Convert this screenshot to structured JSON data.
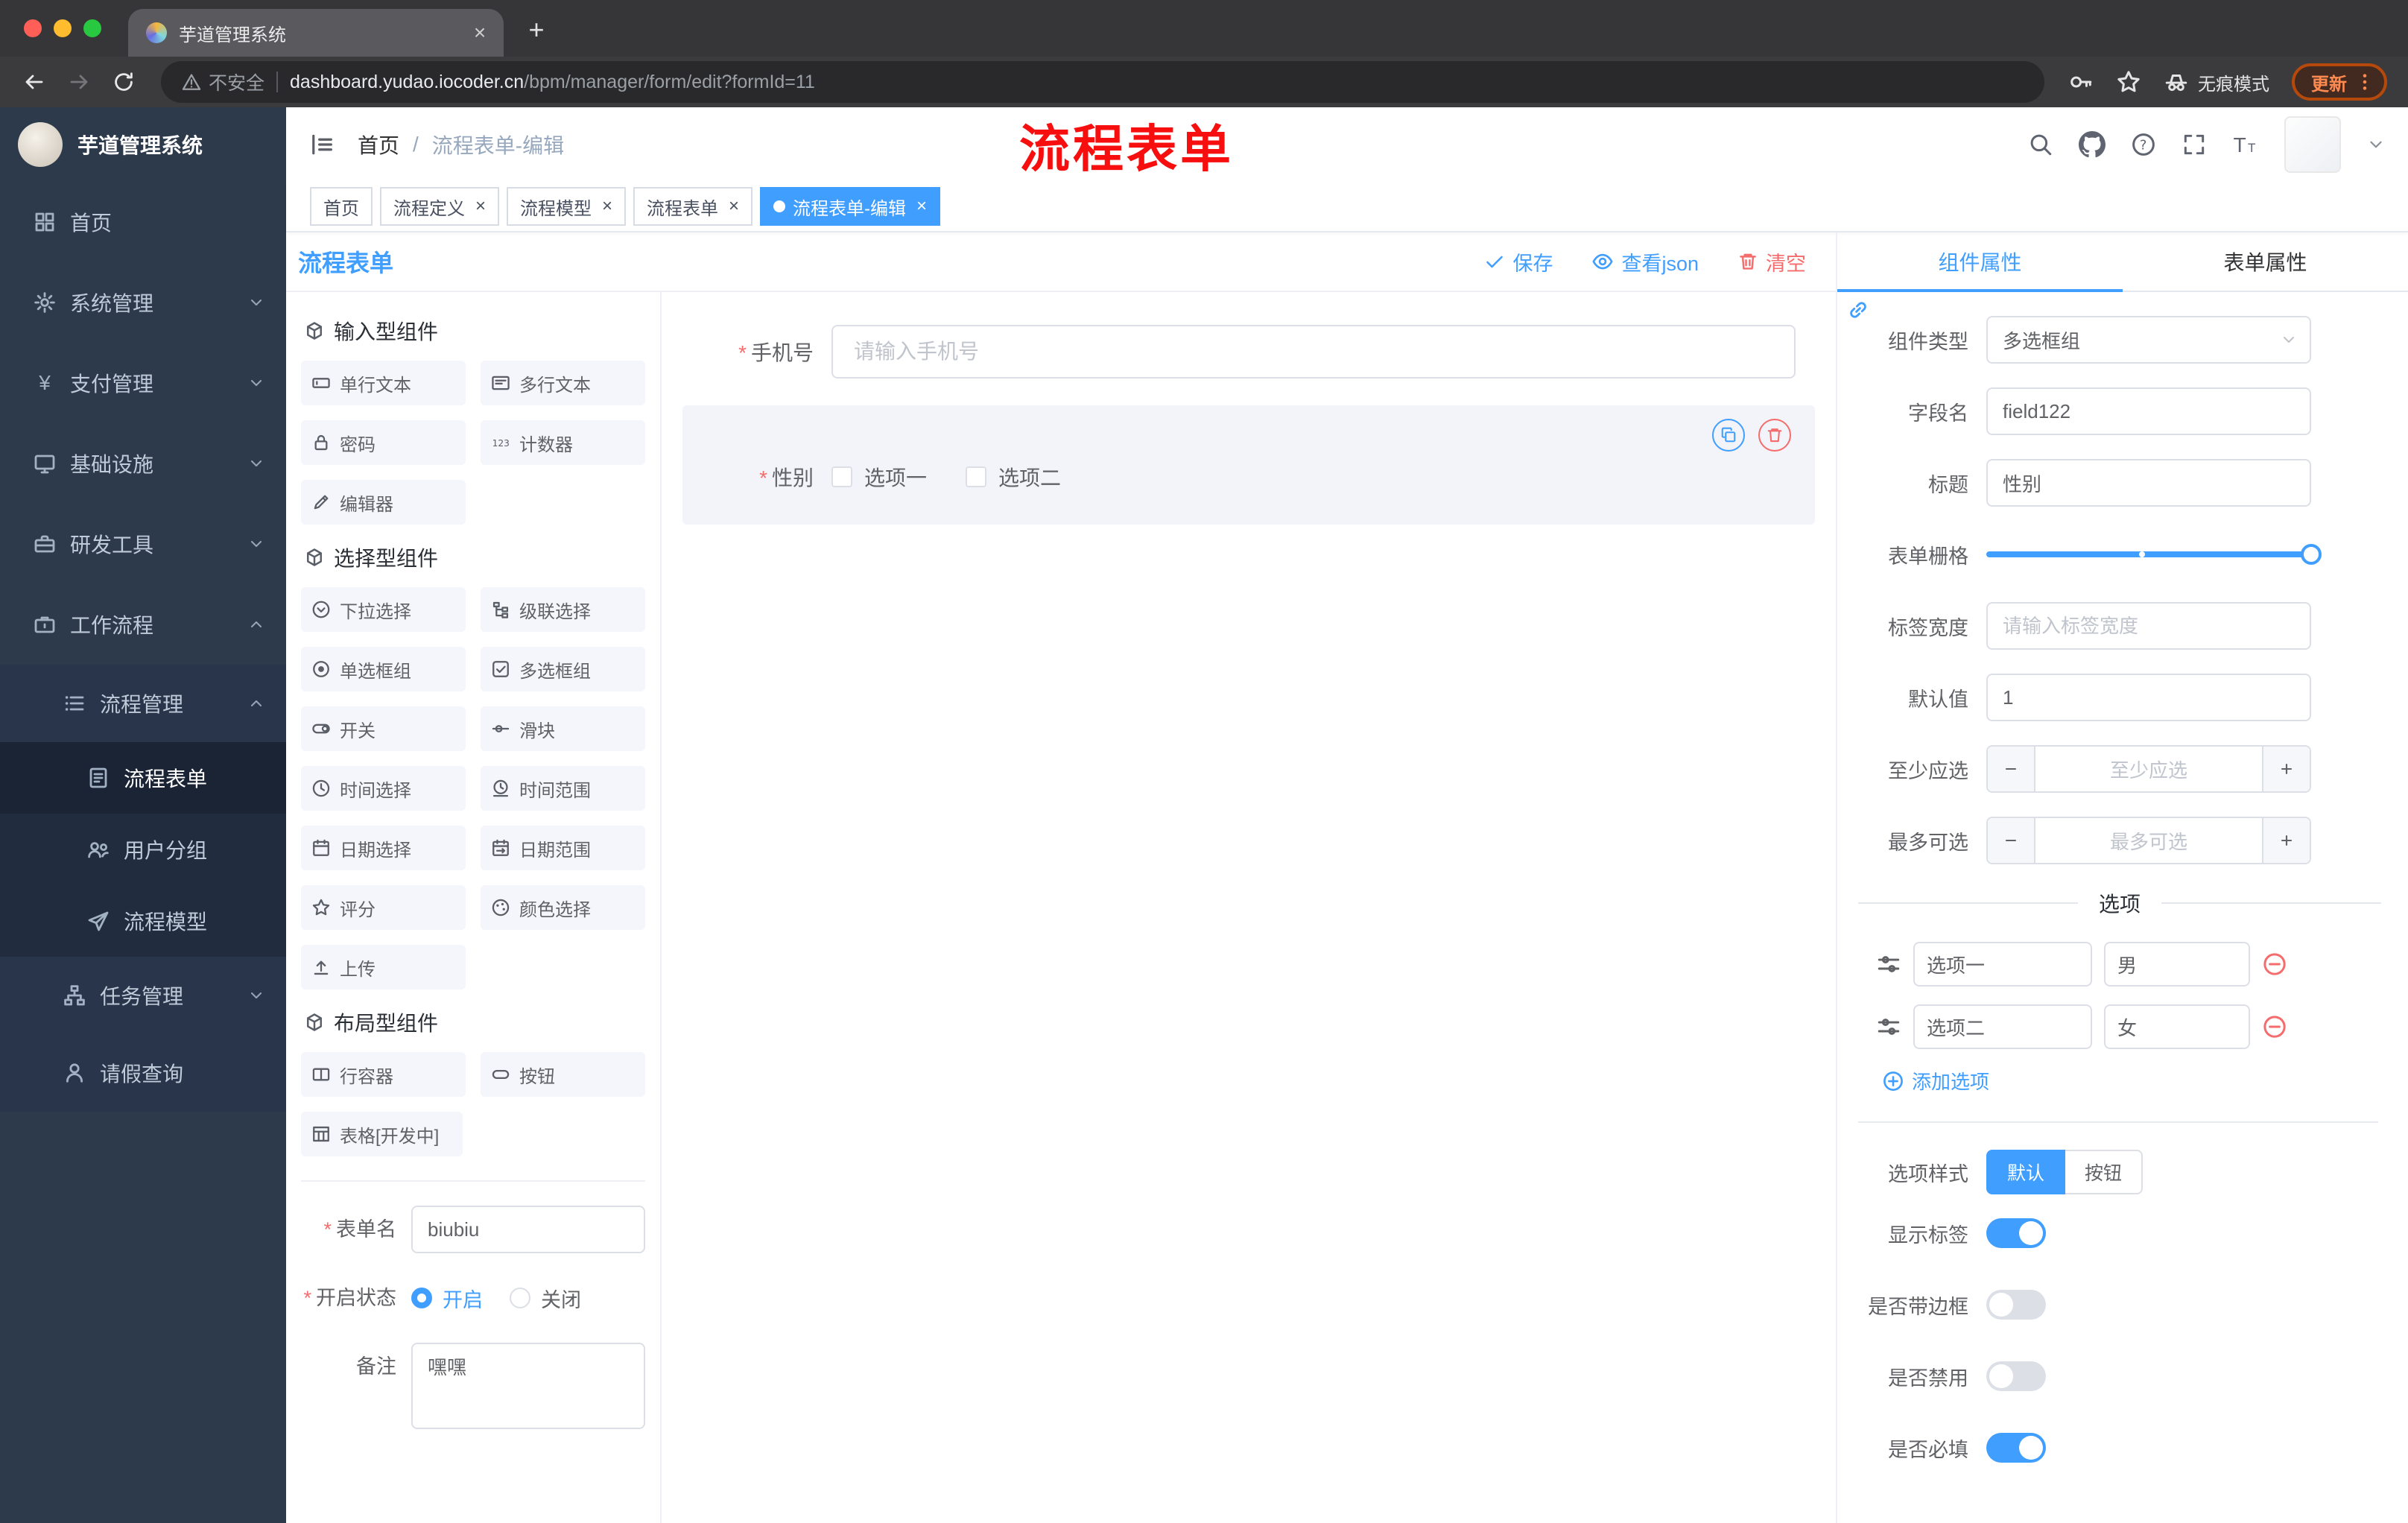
{
  "browser": {
    "tab": {
      "title": "芋道管理系统",
      "favicon": "yudao-favicon"
    },
    "address": {
      "security_label": "不安全",
      "url_domain": "dashboard.yudao.iocoder.cn",
      "url_path": "/bpm/manager/form/edit?formId=11",
      "profile_label": "无痕模式",
      "update_label": "更新"
    }
  },
  "annotation": {
    "text": "流程表单",
    "color": "#f70f0f"
  },
  "sidebar": {
    "logo_title": "芋道管理系统",
    "items": [
      {
        "label": "首页",
        "icon": "home-icon"
      },
      {
        "label": "系统管理",
        "icon": "gear-icon"
      },
      {
        "label": "支付管理",
        "icon": "yen-icon"
      },
      {
        "label": "基础设施",
        "icon": "infra-icon"
      },
      {
        "label": "研发工具",
        "icon": "toolbox-icon"
      },
      {
        "label": "工作流程",
        "icon": "workflow-icon",
        "expanded": true
      }
    ],
    "workflow_children": [
      {
        "label": "流程管理",
        "icon": "list-icon",
        "expanded": true
      },
      {
        "label": "任务管理",
        "icon": "tree-icon"
      },
      {
        "label": "请假查询",
        "icon": "person-icon"
      }
    ],
    "process_children": [
      {
        "label": "流程表单",
        "icon": "form-icon",
        "active": true
      },
      {
        "label": "用户分组",
        "icon": "user-group-icon"
      },
      {
        "label": "流程模型",
        "icon": "paper-plane-icon"
      }
    ]
  },
  "header": {
    "breadcrumb": {
      "root": "首页",
      "separator": "/",
      "current": "流程表单-编辑"
    }
  },
  "tags": [
    {
      "label": "首页"
    },
    {
      "label": "流程定义",
      "closable": true
    },
    {
      "label": "流程模型",
      "closable": true
    },
    {
      "label": "流程表单",
      "closable": true
    },
    {
      "label": "流程表单-编辑",
      "closable": true,
      "active": true
    }
  ],
  "designer": {
    "title": "流程表单",
    "actions": {
      "save": "保存",
      "view_json": "查看json",
      "clear": "清空"
    },
    "groups": [
      {
        "title": "输入型组件",
        "items": [
          {
            "label": "单行文本",
            "icon": "input-icon"
          },
          {
            "label": "多行文本",
            "icon": "textarea-icon"
          },
          {
            "label": "密码",
            "icon": "lock-icon"
          },
          {
            "label": "计数器",
            "icon": "counter-icon"
          },
          {
            "label": "编辑器",
            "icon": "editor-icon"
          }
        ]
      },
      {
        "title": "选择型组件",
        "items": [
          {
            "label": "下拉选择",
            "icon": "select-icon"
          },
          {
            "label": "级联选择",
            "icon": "cascader-icon"
          },
          {
            "label": "单选框组",
            "icon": "radio-icon"
          },
          {
            "label": "多选框组",
            "icon": "checkbox-icon"
          },
          {
            "label": "开关",
            "icon": "switch-icon"
          },
          {
            "label": "滑块",
            "icon": "slider-icon"
          },
          {
            "label": "时间选择",
            "icon": "time-icon"
          },
          {
            "label": "时间范围",
            "icon": "time-range-icon"
          },
          {
            "label": "日期选择",
            "icon": "date-icon"
          },
          {
            "label": "日期范围",
            "icon": "date-range-icon"
          },
          {
            "label": "评分",
            "icon": "star-icon"
          },
          {
            "label": "颜色选择",
            "icon": "color-icon"
          },
          {
            "label": "上传",
            "icon": "upload-icon"
          }
        ]
      },
      {
        "title": "布局型组件",
        "items": [
          {
            "label": "行容器",
            "icon": "row-icon"
          },
          {
            "label": "按钮",
            "icon": "button-icon"
          },
          {
            "label": "表格[开发中]",
            "icon": "table-icon"
          }
        ]
      }
    ],
    "meta": {
      "form_name_label": "表单名",
      "form_name_value": "biubiu",
      "status_label": "开启状态",
      "status_on": "开启",
      "status_off": "关闭",
      "status_value": "开启",
      "remark_label": "备注",
      "remark_value": "嘿嘿"
    },
    "canvas": {
      "phone_field": {
        "label": "手机号",
        "required": true,
        "placeholder": "请输入手机号"
      },
      "gender_field": {
        "label": "性别",
        "required": true,
        "selected": true,
        "options": [
          "选项一",
          "选项二"
        ]
      }
    }
  },
  "props": {
    "tabs": {
      "component": "组件属性",
      "form": "表单属性"
    },
    "active_tab": "组件属性",
    "component_type": {
      "label": "组件类型",
      "value": "多选框组"
    },
    "field_name": {
      "label": "字段名",
      "value": "field122"
    },
    "title": {
      "label": "标题",
      "value": "性别"
    },
    "grid": {
      "label": "表单栅格",
      "value": 24,
      "max": 24,
      "stop_percent": 48
    },
    "label_width": {
      "label": "标签宽度",
      "placeholder": "请输入标签宽度"
    },
    "default_value": {
      "label": "默认值",
      "value": "1"
    },
    "min_select": {
      "label": "至少应选",
      "placeholder": "至少应选"
    },
    "max_select": {
      "label": "最多可选",
      "placeholder": "最多可选"
    },
    "options_title": "选项",
    "options": [
      {
        "label": "选项一",
        "value": "男"
      },
      {
        "label": "选项二",
        "value": "女"
      }
    ],
    "add_option_label": "添加选项",
    "option_style": {
      "label": "选项样式",
      "choice_default": "默认",
      "choice_button": "按钮",
      "value": "默认"
    },
    "switches": [
      {
        "label": "显示标签",
        "on": true
      },
      {
        "label": "是否带边框",
        "on": false
      },
      {
        "label": "是否禁用",
        "on": false
      },
      {
        "label": "是否必填",
        "on": true
      }
    ],
    "colors": {
      "primary": "#409eff",
      "danger": "#f56c6c"
    }
  }
}
